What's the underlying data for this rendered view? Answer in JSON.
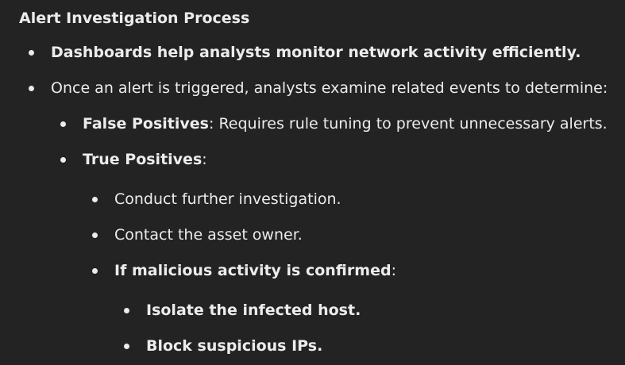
{
  "heading": "Alert Investigation Process",
  "items": [
    {
      "bold": "Dashboards help analysts monitor network activity efficiently.",
      "rest": ""
    },
    {
      "bold": "",
      "rest": "Once an alert is triggered, analysts examine related events to determine:"
    },
    {
      "bold": "False Positives",
      "rest": ": Requires rule tuning to prevent unnecessary alerts."
    },
    {
      "bold": "True Positives",
      "rest": ":"
    },
    {
      "bold": "",
      "rest": "Conduct further investigation."
    },
    {
      "bold": "",
      "rest": "Contact the asset owner."
    },
    {
      "bold": "If malicious activity is confirmed",
      "rest": ":"
    },
    {
      "bold": "Isolate the infected host.",
      "rest": ""
    },
    {
      "bold": "Block suspicious IPs.",
      "rest": ""
    }
  ]
}
